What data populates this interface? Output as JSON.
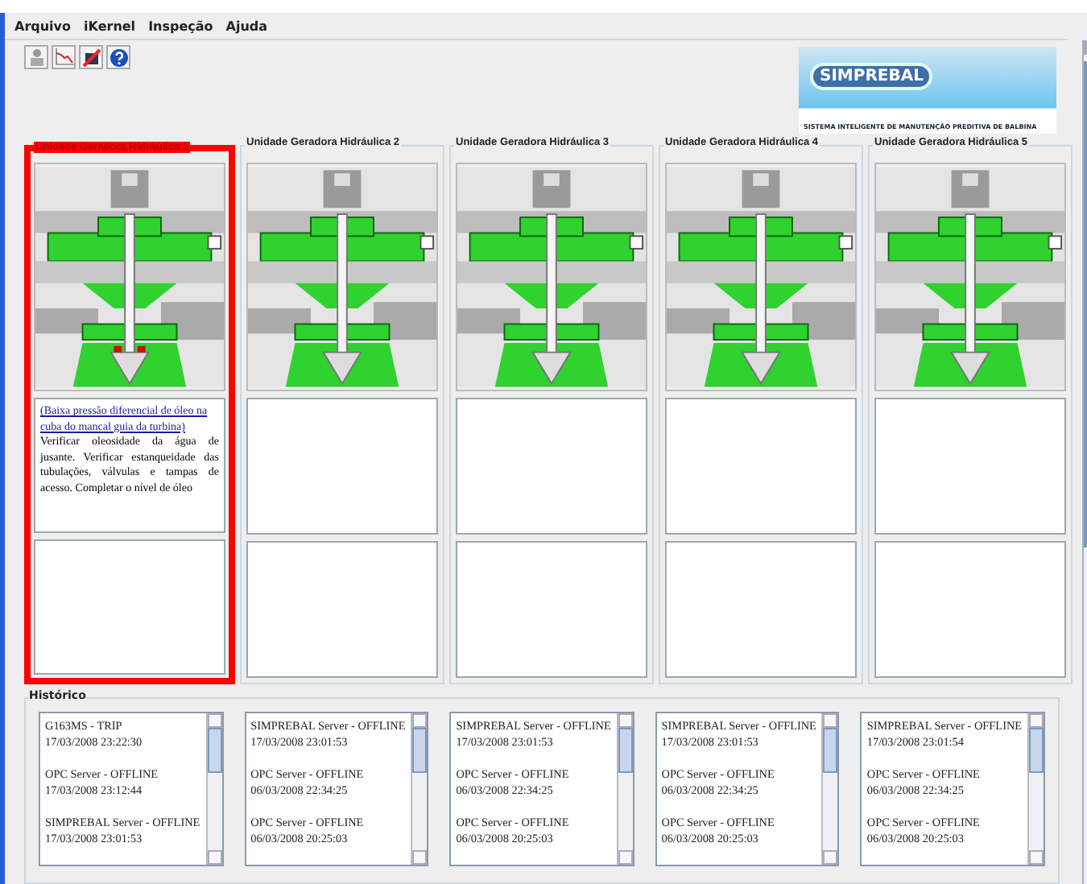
{
  "menu": [
    "Arquivo",
    "iKernel",
    "Inspeção",
    "Ajuda"
  ],
  "logo": {
    "name": "SIMPREBAL",
    "tagline": "SISTEMA INTELIGENTE DE MANUTENÇÃO PREDITIVA DE BALBINA"
  },
  "units": [
    {
      "title": "Unidade Geradora Hidráulica 1",
      "alarm": true,
      "alert_link": "(Baixa pressão diferencial de óleo na cuba do mancal guia da turbina)",
      "alert_text": "Verificar oleosidade da água de jusante. Verificar estanqueidade das tubulações, válvulas e tampas de acesso. Completar o nível de óleo"
    },
    {
      "title": "Unidade Geradora Hidráulica 2",
      "alarm": false
    },
    {
      "title": "Unidade Geradora Hidráulica 3",
      "alarm": false
    },
    {
      "title": "Unidade Geradora Hidráulica 4",
      "alarm": false
    },
    {
      "title": "Unidade Geradora Hidráulica 5",
      "alarm": false
    }
  ],
  "history": {
    "title": "Histórico",
    "lists": [
      [
        {
          "event": "G163MS - TRIP",
          "time": "17/03/2008 23:22:30"
        },
        {
          "event": "OPC Server - OFFLINE",
          "time": "17/03/2008 23:12:44"
        },
        {
          "event": "SIMPREBAL Server - OFFLINE",
          "time": "17/03/2008 23:01:53"
        }
      ],
      [
        {
          "event": "SIMPREBAL Server - OFFLINE",
          "time": "17/03/2008 23:01:53"
        },
        {
          "event": "OPC Server - OFFLINE",
          "time": "06/03/2008 22:34:25"
        },
        {
          "event": "OPC Server - OFFLINE",
          "time": "06/03/2008 20:25:03"
        }
      ],
      [
        {
          "event": "SIMPREBAL Server - OFFLINE",
          "time": "17/03/2008 23:01:53"
        },
        {
          "event": "OPC Server - OFFLINE",
          "time": "06/03/2008 22:34:25"
        },
        {
          "event": "OPC Server - OFFLINE",
          "time": "06/03/2008 20:25:03"
        }
      ],
      [
        {
          "event": "SIMPREBAL Server - OFFLINE",
          "time": "17/03/2008 23:01:53"
        },
        {
          "event": "OPC Server - OFFLINE",
          "time": "06/03/2008 22:34:25"
        },
        {
          "event": "OPC Server - OFFLINE",
          "time": "06/03/2008 20:25:03"
        }
      ],
      [
        {
          "event": "SIMPREBAL Server - OFFLINE",
          "time": "17/03/2008 23:01:54"
        },
        {
          "event": "OPC Server - OFFLINE",
          "time": "06/03/2008 22:34:25"
        },
        {
          "event": "OPC Server - OFFLINE",
          "time": "06/03/2008 20:25:03"
        }
      ]
    ]
  }
}
